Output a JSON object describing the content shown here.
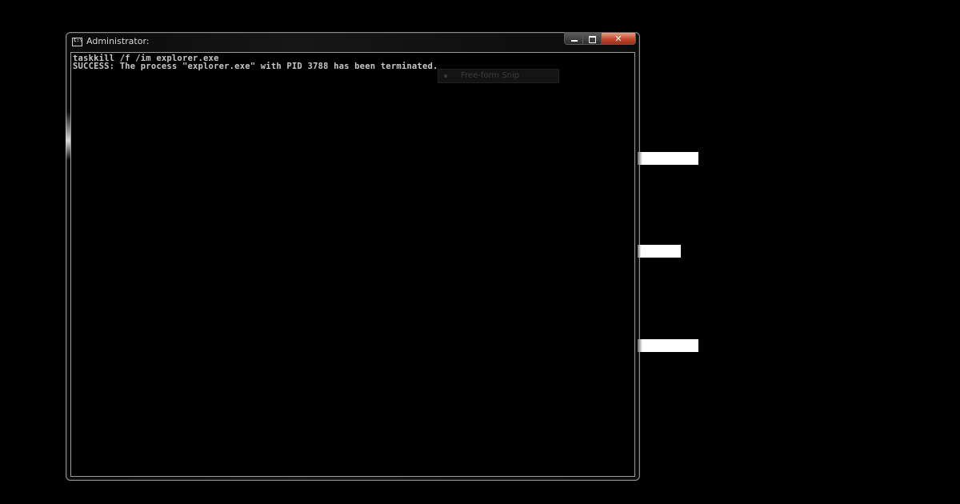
{
  "window": {
    "title": "Administrator:",
    "icon": "command-prompt-icon",
    "icon_text": "C:\\"
  },
  "caption_buttons": {
    "minimize": "minimize-icon",
    "maximize": "maximize-icon",
    "close_glyph": "✕"
  },
  "console": {
    "lines": [
      "taskkill /f /im explorer.exe",
      "SUCCESS: The process \"explorer.exe\" with PID 3788 has been terminated."
    ]
  },
  "snip_menu": {
    "label": "Free-form Snip",
    "icon": "snip-icon"
  },
  "colors": {
    "background": "#000000",
    "console_text": "#c8c8c8",
    "close_button": "#c24a2d"
  }
}
